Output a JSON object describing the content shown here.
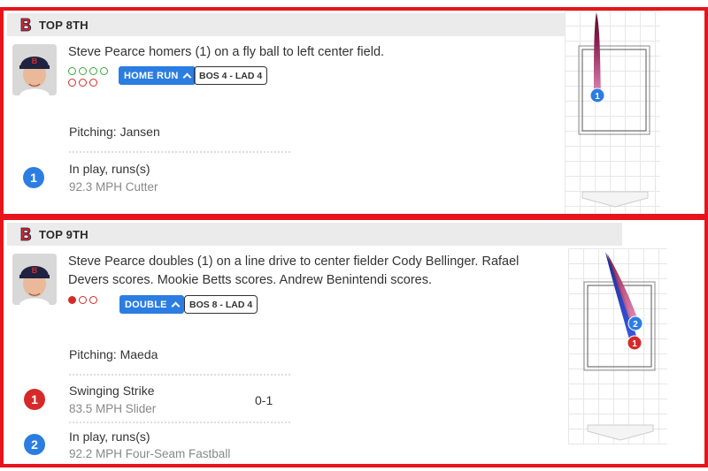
{
  "colors": {
    "frame_red": "#e8141b",
    "accent_blue": "#2b7de1",
    "ball_red": "#d62a2a",
    "strike_green": "#3caa3c",
    "trail_pink": "#d46a9a",
    "trail_dark": "#5a0a28"
  },
  "plays": [
    {
      "inning": "TOP 8TH",
      "team_logo_icon": "red-sox-b-logo-icon",
      "description": "Steve Pearce homers (1) on a fly ball to left center field.",
      "result_label": "HOME RUN",
      "score": "BOS 4 - LAD 4",
      "count_indicator": {
        "balls_filled": 0,
        "strikes_filled": 0,
        "balls_total": 4,
        "strikes_total": 3
      },
      "pitching_label": "Pitching: Jansen",
      "pitches": [
        {
          "number": "1",
          "result": "In play, runs(s)",
          "detail": "92.3 MPH Cutter",
          "count": ""
        }
      ]
    },
    {
      "inning": "TOP 9TH",
      "team_logo_icon": "red-sox-b-logo-icon",
      "description_lines": [
        "Steve Pearce doubles (1) on a line drive to center fielder Cody Bellinger. Rafael",
        "Devers scores. Mookie Betts scores. Andrew Benintendi scores."
      ],
      "result_label": "DOUBLE",
      "score": "BOS 8 - LAD 4",
      "count_indicator": {
        "balls_filled": 0,
        "strikes_filled": 1,
        "balls_total": 4,
        "strikes_total": 3
      },
      "pitching_label": "Pitching: Maeda",
      "pitches": [
        {
          "number": "1",
          "result": "Swinging Strike",
          "detail": "83.5 MPH Slider",
          "count": "0-1"
        },
        {
          "number": "2",
          "result": "In play, runs(s)",
          "detail": "92.2 MPH Four-Seam Fastball",
          "count": ""
        }
      ]
    }
  ]
}
